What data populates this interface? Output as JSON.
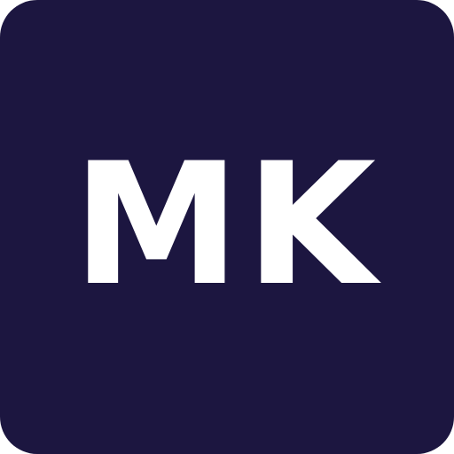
{
  "avatar": {
    "initials": "MK",
    "background_color": "#1c1640",
    "text_color": "#ffffff"
  }
}
